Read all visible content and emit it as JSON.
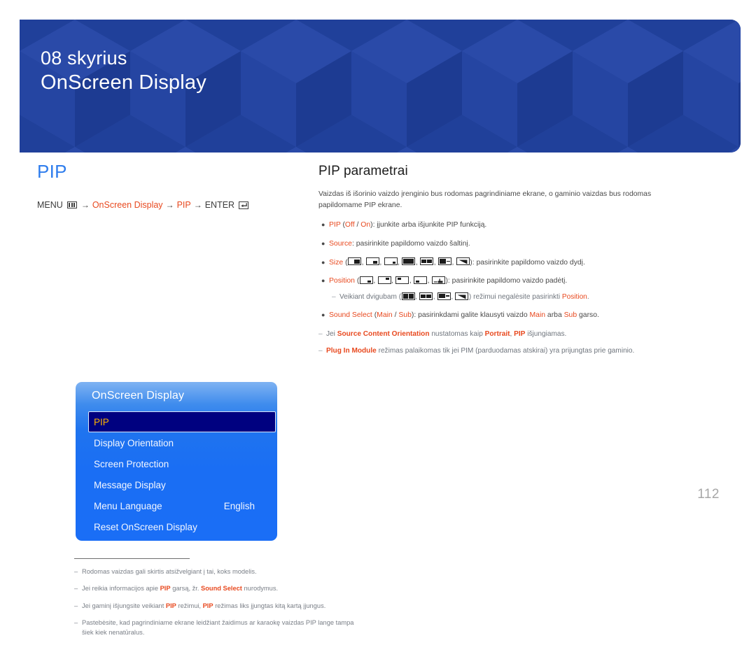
{
  "header": {
    "chapter": "08 skyrius",
    "title": "OnScreen Display",
    "bg_color": "#20409a"
  },
  "left": {
    "section_title": "PIP",
    "section_title_color": "#2f7ded",
    "breadcrumb": {
      "menu_label": "MENU",
      "menu_icon": "menu-bars-icon",
      "arrow1": "→",
      "item1": "OnScreen Display",
      "arrow2": "→",
      "item2": "PIP",
      "arrow3": "→",
      "enter_label": "ENTER",
      "enter_icon": "enter-return-icon",
      "highlight_color": "#e8491f"
    },
    "osd": {
      "title": "OnScreen Display",
      "selected_index": 0,
      "selected_text_color": "#ffb400",
      "selected_bg_color": "#000180",
      "items": [
        {
          "label": "PIP",
          "value": ""
        },
        {
          "label": "Display Orientation",
          "value": ""
        },
        {
          "label": "Screen Protection",
          "value": ""
        },
        {
          "label": "Message Display",
          "value": ""
        },
        {
          "label": "Menu Language",
          "value": "English"
        },
        {
          "label": "Reset OnScreen Display",
          "value": ""
        }
      ]
    },
    "footnotes": [
      {
        "dash": "–",
        "parts": [
          {
            "t": "Rodomas vaizdas gali skirtis atsižvelgiant į tai, koks modelis.",
            "hl": false
          }
        ]
      },
      {
        "dash": "–",
        "parts": [
          {
            "t": "Jei reikia informacijos apie ",
            "hl": false
          },
          {
            "t": "PIP",
            "hl": true
          },
          {
            "t": " garsą, žr. ",
            "hl": false
          },
          {
            "t": "Sound Select",
            "hl": true
          },
          {
            "t": " nurodymus.",
            "hl": false
          }
        ]
      },
      {
        "dash": "–",
        "parts": [
          {
            "t": "Jei gaminį išjungsite veikiant ",
            "hl": false
          },
          {
            "t": "PIP",
            "hl": true
          },
          {
            "t": " režimui, ",
            "hl": false
          },
          {
            "t": "PIP",
            "hl": true
          },
          {
            "t": " režimas liks įjungtas kitą kartą įjungus.",
            "hl": false
          }
        ]
      },
      {
        "dash": "–",
        "parts": [
          {
            "t": "Pastebėsite, kad pagrindiniame ekrane leidžiant žaidimus ar karaokę vaizdas PIP lange tampa šiek kiek nenatūralus.",
            "hl": false
          }
        ]
      }
    ]
  },
  "right": {
    "title": "PIP parametrai",
    "intro": "Vaizdas iš išorinio vaizdo įrenginio bus rodomas pagrindiniame ekrane, o gaminio vaizdas bus rodomas papildomame PIP ekrane.",
    "bullets": [
      {
        "name": "bullet-pip",
        "parts": [
          {
            "t": "PIP",
            "hl": true
          },
          {
            "t": " (",
            "hl": false
          },
          {
            "t": "Off",
            "hl": true
          },
          {
            "t": " / ",
            "hl": false
          },
          {
            "t": "On",
            "hl": true
          },
          {
            "t": "): įjunkite arba išjunkite PIP funkciją.",
            "hl": false
          }
        ],
        "icons": []
      },
      {
        "name": "bullet-source",
        "parts": [
          {
            "t": "Source",
            "hl": true
          },
          {
            "t": ": pasirinkite papildomo vaizdo šaltinį.",
            "hl": false
          }
        ],
        "icons": []
      },
      {
        "name": "bullet-size",
        "prefix": [
          {
            "t": "Size",
            "hl": true
          },
          {
            "t": " (",
            "hl": false
          }
        ],
        "icons": [
          "pip-size-large",
          "pip-size-medium",
          "pip-size-small",
          "pip-split-half",
          "pip-split-wide",
          "pip-split-narrow",
          "pip-diagonal"
        ],
        "suffix": [
          {
            "t": "): pasirinkite papildomo vaizdo dydį.",
            "hl": false
          }
        ]
      },
      {
        "name": "bullet-position",
        "prefix": [
          {
            "t": "Position",
            "hl": true
          },
          {
            "t": " (",
            "hl": false
          }
        ],
        "icons": [
          "pip-pos-bottom-right",
          "pip-pos-top-right",
          "pip-pos-top-left",
          "pip-pos-bottom-left",
          "pip-pos-custom"
        ],
        "suffix": [
          {
            "t": "): pasirinkite papildomo vaizdo padėtį.",
            "hl": false
          }
        ]
      }
    ],
    "subnote": {
      "dash": "–",
      "prefix": [
        {
          "t": "Veikiant dvigubam (",
          "hl": false
        }
      ],
      "icons": [
        "pip-split-half",
        "pip-split-wide",
        "pip-split-narrow",
        "pip-diagonal"
      ],
      "suffix": [
        {
          "t": ") režimui negalėsite pasirinkti ",
          "hl": false
        },
        {
          "t": "Position",
          "hl": true
        },
        {
          "t": ".",
          "hl": false
        }
      ]
    },
    "bullet_sound": {
      "name": "bullet-sound-select",
      "parts": [
        {
          "t": "Sound Select",
          "hl": true
        },
        {
          "t": " (",
          "hl": false
        },
        {
          "t": "Main",
          "hl": true
        },
        {
          "t": " / ",
          "hl": false
        },
        {
          "t": "Sub",
          "hl": true
        },
        {
          "t": "): pasirinkdami galite klausyti vaizdo ",
          "hl": false
        },
        {
          "t": "Main",
          "hl": true
        },
        {
          "t": " arba ",
          "hl": false
        },
        {
          "t": "Sub",
          "hl": true
        },
        {
          "t": " garso.",
          "hl": false
        }
      ]
    },
    "notes": [
      {
        "dash": "–",
        "parts": [
          {
            "t": "Jei ",
            "hl": false
          },
          {
            "t": "Source Content Orientation",
            "hl": true,
            "bold": true
          },
          {
            "t": " nustatomas kaip ",
            "hl": false
          },
          {
            "t": "Portrait",
            "hl": true,
            "bold": true
          },
          {
            "t": ", ",
            "hl": false
          },
          {
            "t": "PIP",
            "hl": true,
            "bold": true
          },
          {
            "t": " išjungiamas.",
            "hl": false
          }
        ]
      },
      {
        "dash": "–",
        "parts": [
          {
            "t": "Plug In Module",
            "hl": true,
            "bold": true
          },
          {
            "t": " režimas palaikomas tik jei PIM (parduodamas atskirai) yra prijungtas prie gaminio.",
            "hl": false
          }
        ]
      }
    ]
  },
  "page_number": "112"
}
